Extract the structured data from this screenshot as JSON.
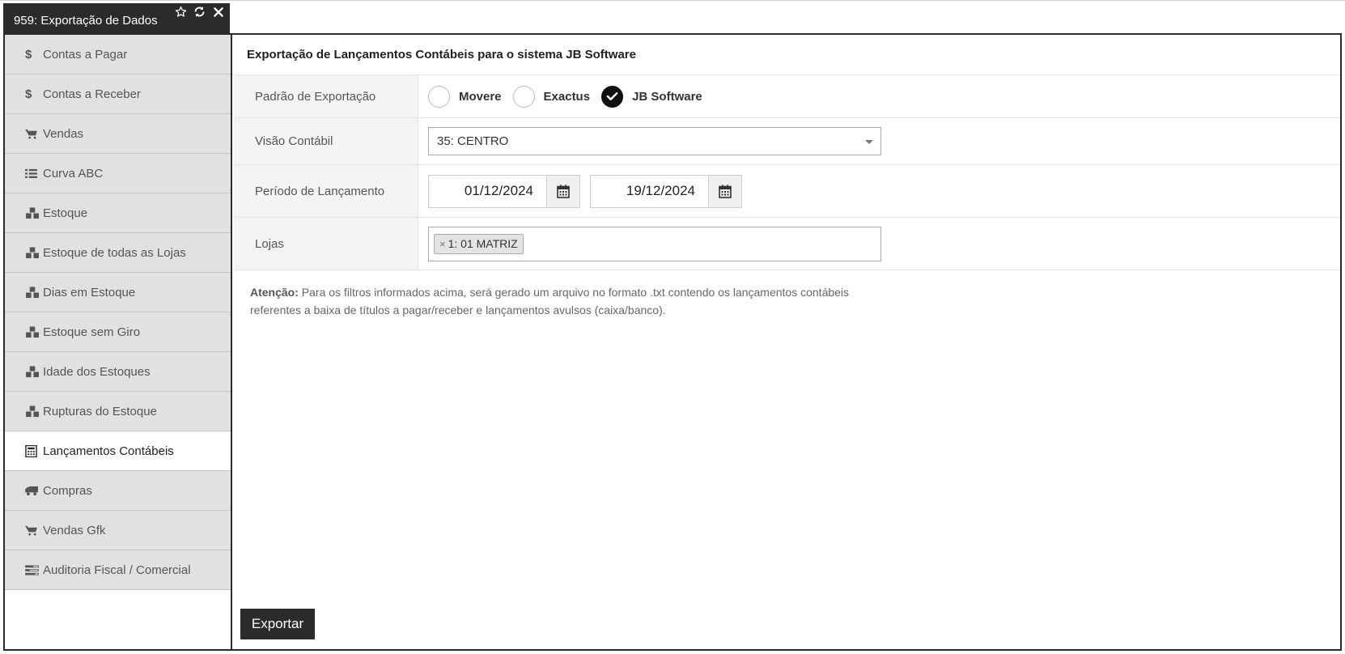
{
  "window": {
    "title": "959: Exportação de Dados",
    "icons": [
      "star-icon",
      "refresh-icon",
      "close-icon"
    ]
  },
  "sidebar": {
    "items": [
      {
        "label": "Contas a Pagar",
        "icon": "dollar-icon",
        "active": false
      },
      {
        "label": "Contas a Receber",
        "icon": "dollar-icon",
        "active": false
      },
      {
        "label": "Vendas",
        "icon": "cart-icon",
        "active": false
      },
      {
        "label": "Curva ABC",
        "icon": "list-icon",
        "active": false
      },
      {
        "label": "Estoque",
        "icon": "cubes-icon",
        "active": false
      },
      {
        "label": "Estoque de todas as Lojas",
        "icon": "cubes-icon",
        "active": false
      },
      {
        "label": "Dias em Estoque",
        "icon": "cubes-icon",
        "active": false
      },
      {
        "label": "Estoque sem Giro",
        "icon": "cubes-icon",
        "active": false
      },
      {
        "label": "Idade dos Estoques",
        "icon": "cubes-icon",
        "active": false
      },
      {
        "label": "Rupturas do Estoque",
        "icon": "cubes-icon",
        "active": false
      },
      {
        "label": "Lançamentos Contábeis",
        "icon": "calculator-icon",
        "active": true
      },
      {
        "label": "Compras",
        "icon": "truck-icon",
        "active": false
      },
      {
        "label": "Vendas Gfk",
        "icon": "cart-icon",
        "active": false
      },
      {
        "label": "Auditoria Fiscal / Comercial",
        "icon": "tasks-icon",
        "active": false
      }
    ]
  },
  "main": {
    "title": "Exportação de Lançamentos Contábeis para o sistema JB Software",
    "padrao": {
      "label": "Padrão de Exportação",
      "options": [
        {
          "label": "Movere",
          "checked": false
        },
        {
          "label": "Exactus",
          "checked": false
        },
        {
          "label": "JB Software",
          "checked": true
        }
      ]
    },
    "visao": {
      "label": "Visão Contábil",
      "selected": "35: CENTRO"
    },
    "periodo": {
      "label": "Período de Lançamento",
      "start": "01/12/2024",
      "end": "19/12/2024"
    },
    "lojas": {
      "label": "Lojas",
      "tags": [
        {
          "remove": "×",
          "label": "1: 01 MATRIZ"
        }
      ]
    },
    "notice": {
      "strong": "Atenção:",
      "text": " Para os filtros informados acima, será gerado um arquivo no formato .txt contendo os lançamentos contábeis referentes a baixa de títulos a pagar/receber e lançamentos avulsos (caixa/banco)."
    },
    "export_label": "Exportar"
  },
  "colors": {
    "dark": "#2b2b2b",
    "sidebar_bg": "#e1e1e1",
    "label_bg": "#f4f4f4",
    "checked": "#111111"
  }
}
